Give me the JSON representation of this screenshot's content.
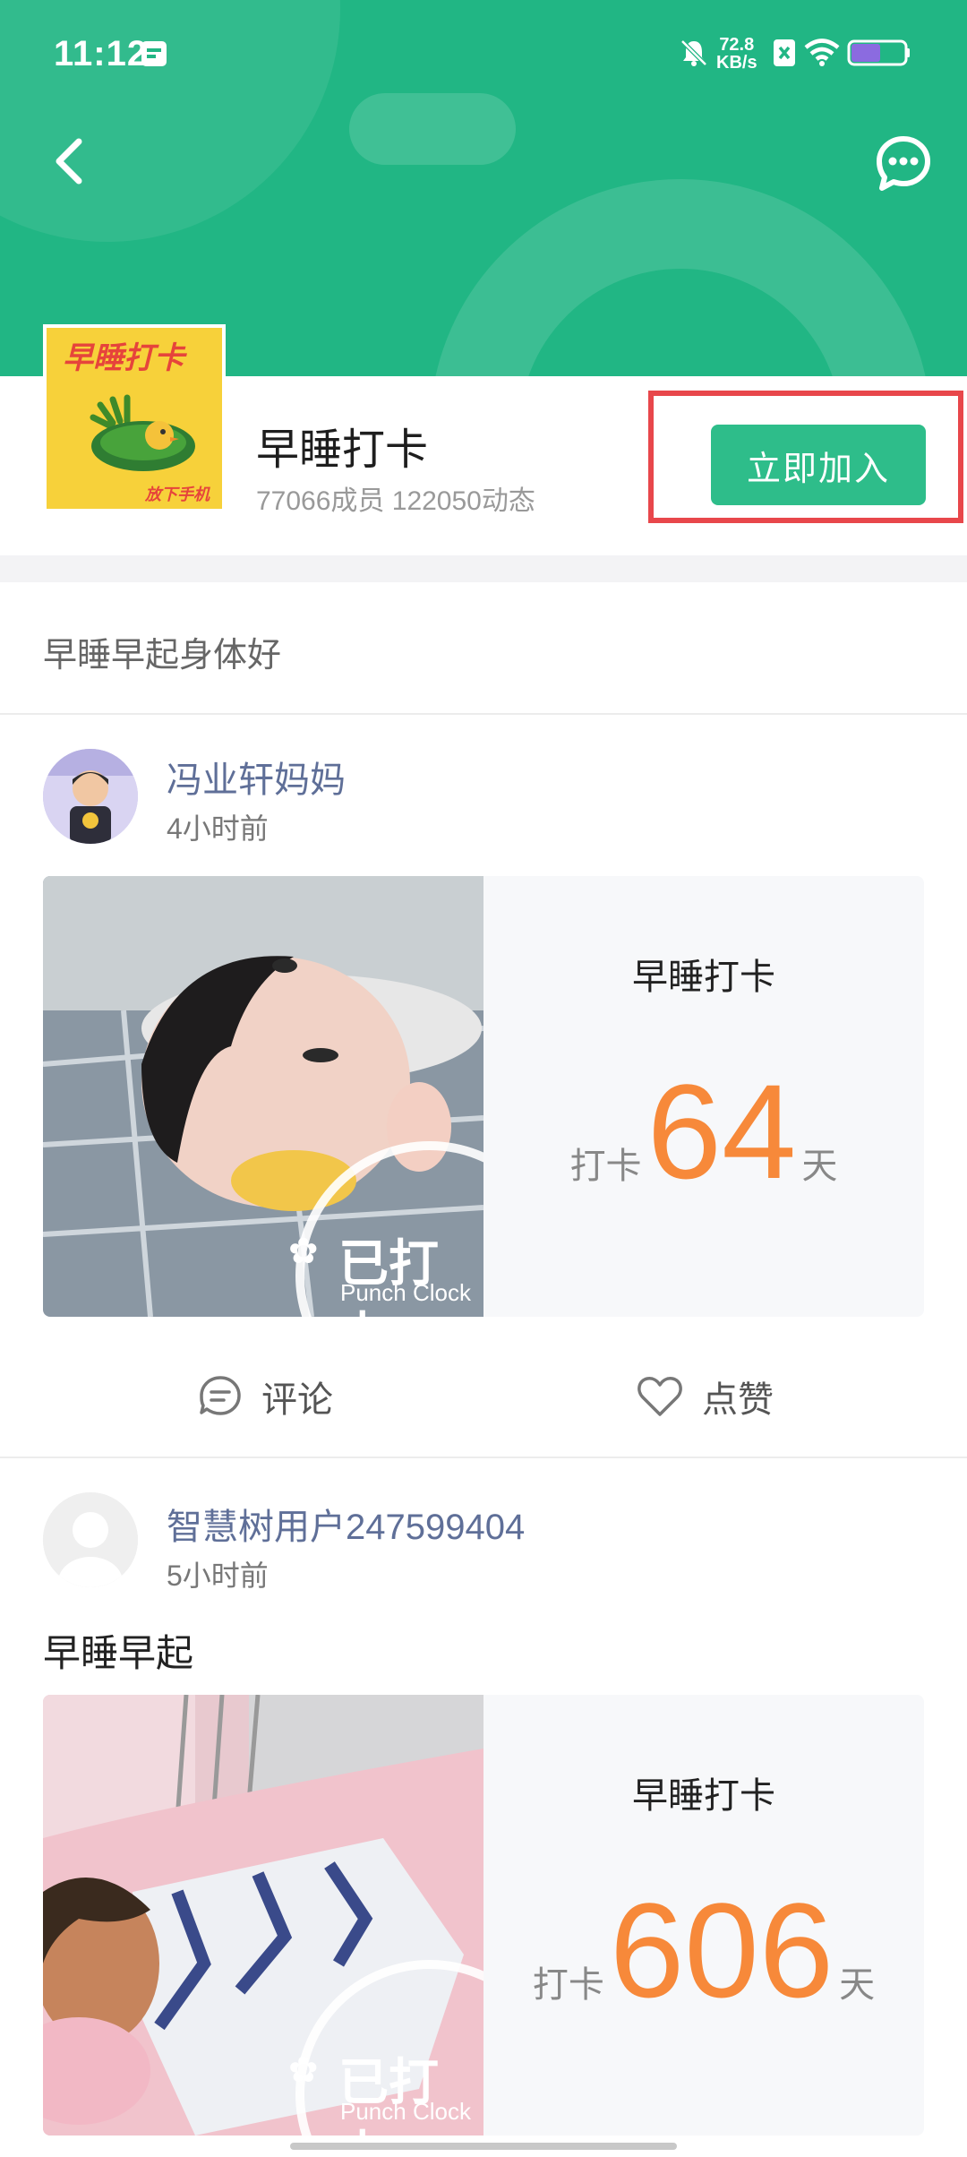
{
  "status_bar": {
    "time": "11:12",
    "net_speed_value": "72.8",
    "net_speed_unit": "KB/s"
  },
  "group": {
    "logo_title": "早睡打卡",
    "logo_subtitle": "放下手机",
    "name": "早睡打卡",
    "stats": "77066成员 122050动态",
    "join_label": "立即加入",
    "description": "早睡早起身体好"
  },
  "posts": [
    {
      "author": "冯业轩妈妈",
      "time": "4小时前",
      "text": "",
      "card_title": "早睡打卡",
      "count_prefix": "打卡",
      "count": "64",
      "count_suffix": "天",
      "stamp_text": "已打卡",
      "stamp_sub": "Punch Clock"
    },
    {
      "author": "智慧树用户247599404",
      "time": "5小时前",
      "text": "早睡早起",
      "card_title": "早睡打卡",
      "count_prefix": "打卡",
      "count": "606",
      "count_suffix": "天",
      "stamp_text": "已打卡",
      "stamp_sub": "Punch Clock"
    }
  ],
  "actions": {
    "comment_label": "评论",
    "like_label": "点赞"
  },
  "colors": {
    "header_green": "#21b684",
    "join_button": "#2ebd8a",
    "highlight_red": "#e8474b",
    "count_orange": "#f7893a",
    "author_blue": "#5f6f98"
  },
  "icons": [
    "back-arrow-icon",
    "chat-bubble-icon",
    "comment-icon",
    "heart-icon",
    "mute-bell-icon",
    "wifi-icon",
    "battery-icon",
    "calendar-icon",
    "sim-icon"
  ]
}
